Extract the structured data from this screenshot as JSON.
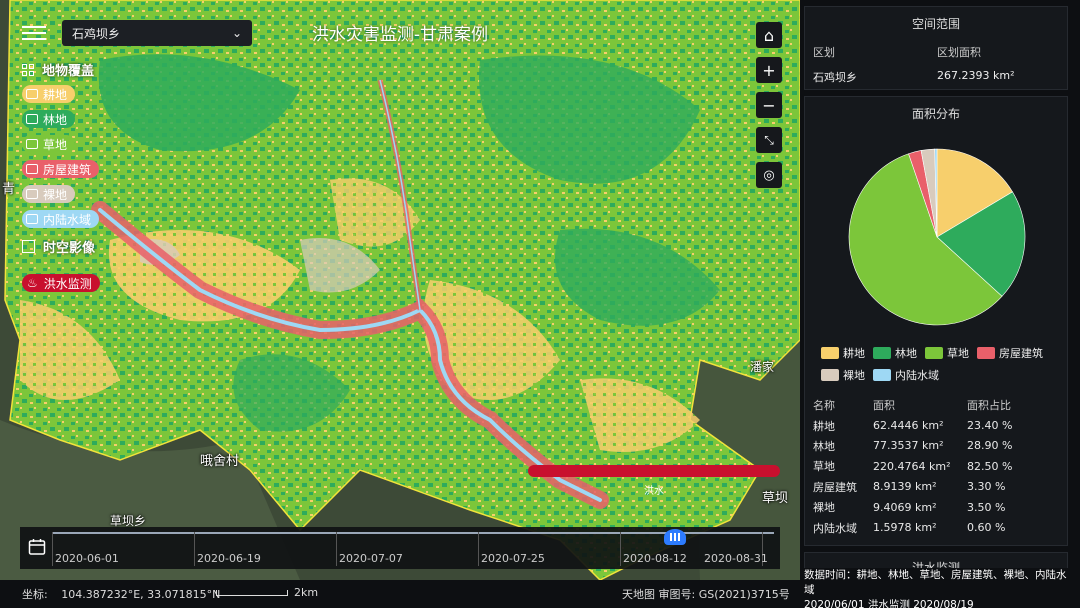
{
  "map": {
    "title": "洪水灾害监测-甘肃案例",
    "region_select": "石鸡坝乡",
    "flood_label": "洪水",
    "places": [
      "哦舍村",
      "草坝乡",
      "草坝",
      "青",
      "潘家"
    ]
  },
  "legend": {
    "landcover_header": "地物覆盖",
    "items": [
      {
        "label": "耕地",
        "color": "#f7cf6c",
        "icon": "farmland-icon"
      },
      {
        "label": "林地",
        "color": "#2eab5c",
        "icon": "tree-icon"
      },
      {
        "label": "草地",
        "color": "#7cc63a",
        "icon": "grass-icon"
      },
      {
        "label": "房屋建筑",
        "color": "#e9606a",
        "icon": "building-icon"
      },
      {
        "label": "裸地",
        "color": "#d8cbbd",
        "icon": "bareland-icon"
      },
      {
        "label": "内陆水域",
        "color": "#9ed8f4",
        "icon": "water-icon"
      }
    ],
    "imagery_header": "时空影像",
    "flood_chip": "洪水监测"
  },
  "timeline": {
    "dates": [
      "2020-06-01",
      "2020-06-19",
      "2020-07-07",
      "2020-07-25",
      "2020-08-12",
      "2020-08-31"
    ]
  },
  "status": {
    "coords_label": "坐标:",
    "coords": "104.387232°E, 33.071815°N",
    "scale": "2km",
    "attribution": "天地图 审图号: GS(2021)3715号"
  },
  "extent": {
    "title": "空间范围",
    "col_region": "区划",
    "col_area": "区划面积",
    "region": "石鸡坝乡",
    "area": "267.2393 km²"
  },
  "distribution": {
    "title": "面积分布",
    "col_name": "名称",
    "col_area": "面积",
    "col_pct": "面积占比",
    "rows": [
      {
        "name": "耕地",
        "area": "62.4446 km²",
        "pct": "23.40 %"
      },
      {
        "name": "林地",
        "area": "77.3537 km²",
        "pct": "28.90 %"
      },
      {
        "name": "草地",
        "area": "220.4764 km²",
        "pct": "82.50 %"
      },
      {
        "name": "房屋建筑",
        "area": "8.9139 km²",
        "pct": "3.30 %"
      },
      {
        "name": "裸地",
        "area": "9.4069 km²",
        "pct": "3.50 %"
      },
      {
        "name": "内陆水域",
        "area": "1.5978 km²",
        "pct": "0.60 %"
      }
    ]
  },
  "chart_data": {
    "type": "pie",
    "labels": [
      "耕地",
      "林地",
      "草地",
      "房屋建筑",
      "裸地",
      "内陆水域"
    ],
    "values": [
      62.4446,
      77.3537,
      220.4764,
      8.9139,
      9.4069,
      1.5978
    ],
    "colors": [
      "#f7cf6c",
      "#2eab5c",
      "#7cc63a",
      "#e9606a",
      "#d8cbbd",
      "#9ed8f4"
    ],
    "title": "面积分布",
    "legend": "bottom"
  },
  "flood_panel": {
    "title": "洪水监测"
  },
  "data_info": {
    "line1": "数据时间：耕地、林地、草地、房屋建筑、裸地、内陆水域",
    "line2": "2020/06/01 洪水监测 2020/08/19"
  }
}
